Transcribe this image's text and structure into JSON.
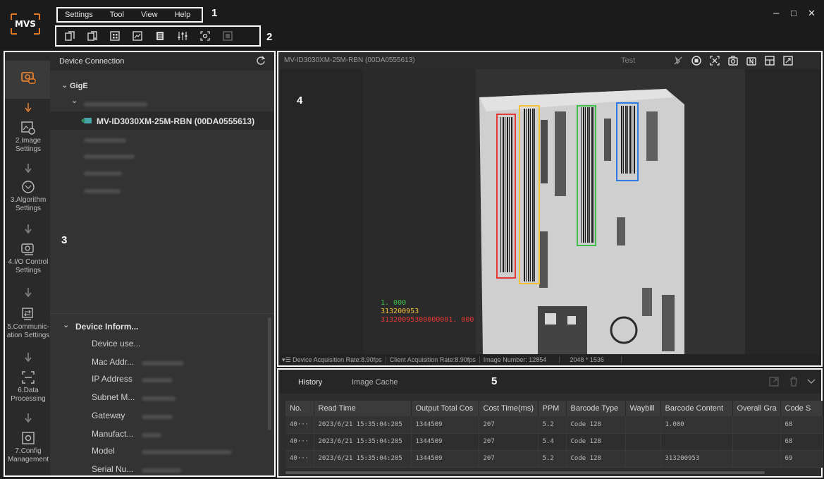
{
  "menu": {
    "items": [
      "Settings",
      "Tool",
      "View",
      "Help"
    ]
  },
  "callouts": {
    "menu": "1",
    "toolbar": "2",
    "device": "3",
    "image": "4",
    "history": "5"
  },
  "toolbar": {
    "icons": [
      "copy-icon",
      "copy-list-icon",
      "grid-icon",
      "chart-icon",
      "notes-icon",
      "sliders-icon",
      "focus-icon",
      "frame-icon"
    ]
  },
  "window": {
    "minimize": "–",
    "maximize": "□",
    "close": "✕"
  },
  "nav": {
    "steps": [
      {
        "icon": "camera-link-icon",
        "label": ""
      },
      {
        "icon": "image-settings-icon",
        "label": "2.Image Settings"
      },
      {
        "icon": "algorithm-icon",
        "label": "3.Algorithm Settings"
      },
      {
        "icon": "io-control-icon",
        "label": "4.I/O Control Settings"
      },
      {
        "icon": "communication-icon",
        "label": "5.Communic-ation Settings"
      },
      {
        "icon": "data-processing-icon",
        "label": "6.Data Processing"
      },
      {
        "icon": "config-icon",
        "label": "7.Config Management"
      }
    ]
  },
  "device": {
    "header": "Device Connection",
    "group": "GigE",
    "selected": "MV-ID3030XM-25M-RBN (00DA0555613)",
    "info_header": "Device Inform...",
    "info_labels": [
      "Device use...",
      "Mac Addr...",
      "IP Address",
      "Subnet M...",
      "Gateway",
      "Manufact...",
      "Model",
      "Serial Nu..."
    ]
  },
  "image": {
    "title": "MV-ID3030XM-25M-RBN (00DA0555613)",
    "mode": "Test",
    "overlay": {
      "line1": "1. 000",
      "line2": "313200953",
      "line3": "31320095300000001. 000"
    },
    "status": {
      "device_rate": "Device Acquisition Rate:8.90fps",
      "client_rate": "Client Acquisition Rate:8.90fps",
      "image_number": "Image Number: 12854",
      "resolution": "2048 * 1536"
    },
    "colors": {
      "red": "#e53935",
      "yellow": "#f3c03a",
      "green": "#3fc04a",
      "blue": "#2f7de0"
    }
  },
  "history": {
    "tabs": [
      "History",
      "Image Cache"
    ],
    "columns": [
      "No.",
      "Read Time",
      "Output Total Cos",
      "Cost Time(ms)",
      "PPM",
      "Barcode Type",
      "Waybill",
      "Barcode Content",
      "Overall Gra",
      "Code S"
    ],
    "rows": [
      [
        "40···",
        "2023/6/21 15:35:04:205",
        "1344509",
        "207",
        "5.2",
        "Code 128",
        "",
        "1.000",
        "",
        "68"
      ],
      [
        "40···",
        "2023/6/21 15:35:04:205",
        "1344509",
        "207",
        "5.4",
        "Code 128",
        "",
        "",
        "",
        "68"
      ],
      [
        "40···",
        "2023/6/21 15:35:04:205",
        "1344509",
        "207",
        "5.2",
        "Code 128",
        "",
        "313200953",
        "",
        "69"
      ]
    ]
  }
}
